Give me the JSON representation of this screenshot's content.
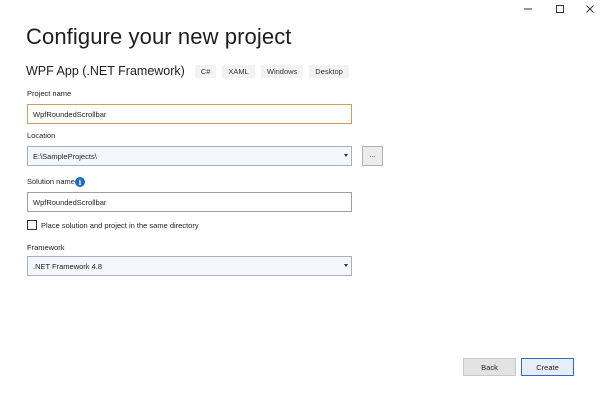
{
  "window": {
    "controls": [
      "minimize-icon",
      "maximize-icon",
      "close-icon"
    ]
  },
  "title": "Configure your new project",
  "template": {
    "name": "WPF App (.NET Framework)",
    "tags": [
      "C#",
      "XAML",
      "Windows",
      "Desktop"
    ]
  },
  "project_name": {
    "label": "Project name",
    "value": "WpfRoundedScrollbar"
  },
  "location": {
    "label": "Location",
    "value": "E:\\SampleProjects\\",
    "browse_label": "..."
  },
  "solution_name": {
    "label": "Solution name",
    "info_icon": "i",
    "value": "WpfRoundedScrollbar"
  },
  "same_directory": {
    "label": "Place solution and project in the same directory",
    "checked": false
  },
  "framework": {
    "label": "Framework",
    "value": ".NET Framework 4.8"
  },
  "buttons": {
    "back": "Back",
    "create": "Create"
  },
  "colors": {
    "accent": "#2a6ad1",
    "info": "#1b6ac9",
    "focus_border": "#c9a15d"
  }
}
